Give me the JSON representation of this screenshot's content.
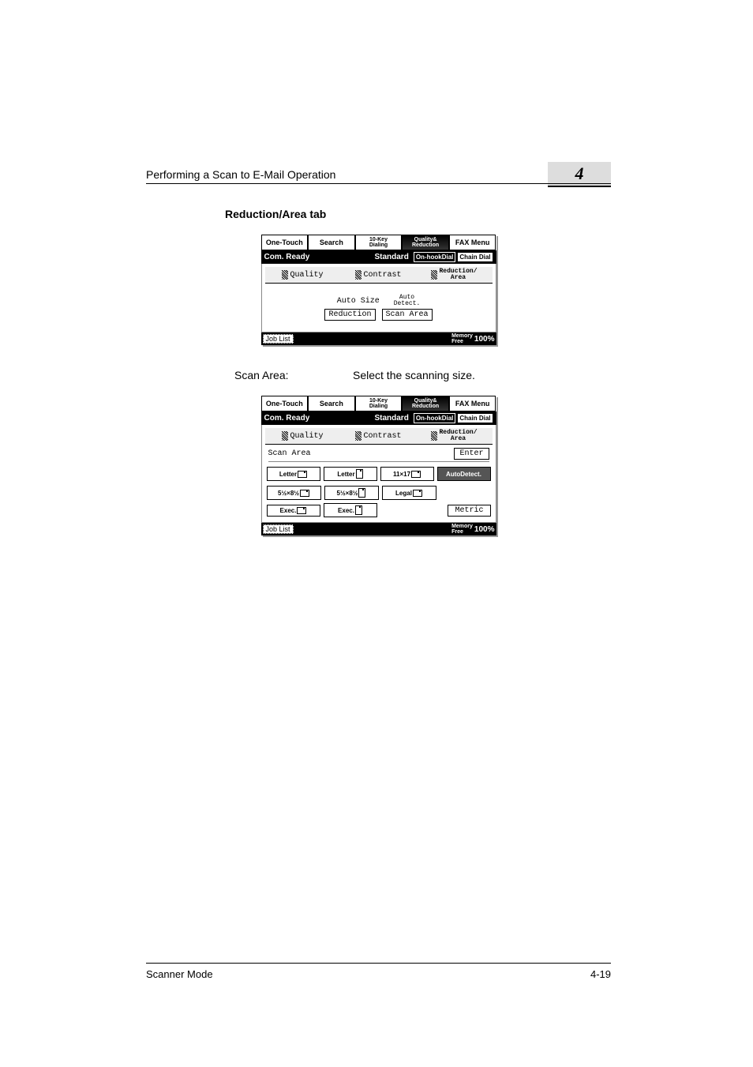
{
  "header": {
    "title": "Performing a Scan to E-Mail Operation",
    "chapter": "4"
  },
  "section_title": "Reduction/Area tab",
  "lcd1": {
    "tabs": {
      "one_touch": "One-Touch",
      "search": "Search",
      "ten_key_line1": "10-Key",
      "ten_key_line2": "Dialing",
      "quality_line1": "Quality&",
      "quality_line2": "Reduction",
      "fax_menu": "FAX Menu"
    },
    "status": {
      "ready": "Com. Ready",
      "standard": "Standard",
      "on_hook": "On-hookDial",
      "chain": "Chain Dial"
    },
    "inner_tabs": {
      "quality": "Quality",
      "contrast": "Contrast",
      "reduction_line1": "Reduction/",
      "reduction_line2": "Area"
    },
    "center": {
      "auto_size": "Auto Size",
      "auto_line1": "Auto",
      "auto_line2": "Detect.",
      "reduction": "Reduction",
      "scan_area": "Scan Area"
    },
    "footer": {
      "job_list": "Job List",
      "mem_line1": "Memory",
      "mem_line2": "Free",
      "pct": "100%"
    }
  },
  "desc": {
    "label": "Scan Area:",
    "text": "Select the scanning size."
  },
  "lcd2": {
    "scan_area_label": "Scan Area",
    "enter": "Enter",
    "sizes": {
      "letter_l": "Letter",
      "letter_p": "Letter",
      "s11x17": "11×17",
      "auto_detect": "AutoDetect.",
      "s55x85_l": "5½×8½",
      "s55x85_p": "5½×8½",
      "legal": "Legal",
      "exec_l": "Exec.",
      "exec_p": "Exec."
    },
    "metric": "Metric"
  },
  "page_footer": {
    "left": "Scanner Mode",
    "right": "4-19"
  }
}
